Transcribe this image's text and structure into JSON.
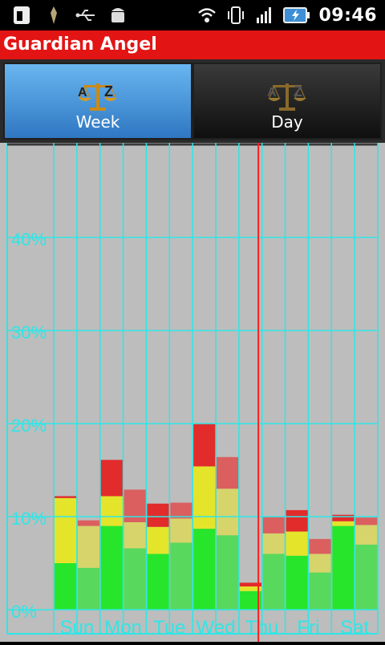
{
  "status_bar": {
    "time": "09:46",
    "icons": [
      "sim-card-icon",
      "notification-icon",
      "usb-icon",
      "android-debug-icon",
      "wifi-icon",
      "vibrate-icon",
      "signal-icon",
      "battery-charging-icon"
    ]
  },
  "app": {
    "title": "Guardian Angel"
  },
  "tabs": [
    {
      "label": "Week",
      "icon": "scales-icon",
      "selected": true
    },
    {
      "label": "Day",
      "icon": "scales-icon",
      "selected": false
    }
  ],
  "colors": {
    "grid": "#2fe6e6",
    "marker": "#ff2020",
    "background": "#bdbdbd",
    "red": "#e22b2b",
    "yellow": "#e4e42b",
    "green": "#27e52b",
    "red_light": "#db5f5f",
    "yellow_light": "#d6d46a",
    "green_light": "#59d85e"
  },
  "chart_data": {
    "type": "bar",
    "y_tick_labels": [
      "0%",
      "10%",
      "20%",
      "30%",
      "40%"
    ],
    "ylim": [
      0,
      50
    ],
    "x_tick_labels": [
      "Sun",
      "Mon",
      "Tue",
      "Wed",
      "Thu",
      "Fri",
      "Sat"
    ],
    "grid": true,
    "stack_order": [
      "green",
      "yellow",
      "red"
    ],
    "bars": [
      {
        "day": "Sun",
        "half": 1,
        "green": 5.0,
        "yellow": 7.0,
        "red": 0.2
      },
      {
        "day": "Sun",
        "half": 2,
        "green": 4.5,
        "yellow": 4.5,
        "red": 0.6
      },
      {
        "day": "Mon",
        "half": 1,
        "green": 9.0,
        "yellow": 3.2,
        "red": 3.9
      },
      {
        "day": "Mon",
        "half": 2,
        "green": 6.6,
        "yellow": 2.8,
        "red": 3.5
      },
      {
        "day": "Tue",
        "half": 1,
        "green": 6.0,
        "yellow": 2.9,
        "red": 2.5
      },
      {
        "day": "Tue",
        "half": 2,
        "green": 7.2,
        "yellow": 2.6,
        "red": 1.7
      },
      {
        "day": "Wed",
        "half": 1,
        "green": 8.7,
        "yellow": 6.7,
        "red": 4.6
      },
      {
        "day": "Wed",
        "half": 2,
        "green": 8.0,
        "yellow": 5.0,
        "red": 3.4
      },
      {
        "day": "Thu",
        "half": 1,
        "green": 2.0,
        "yellow": 0.5,
        "red": 0.4
      },
      {
        "day": "Thu",
        "half": 2,
        "green": 6.0,
        "yellow": 2.2,
        "red": 1.8
      },
      {
        "day": "Fri",
        "half": 1,
        "green": 5.8,
        "yellow": 2.6,
        "red": 2.3
      },
      {
        "day": "Fri",
        "half": 2,
        "green": 4.0,
        "yellow": 2.0,
        "red": 1.6
      },
      {
        "day": "Sat",
        "half": 1,
        "green": 9.0,
        "yellow": 0.5,
        "red": 0.7
      },
      {
        "day": "Sat",
        "half": 2,
        "green": 7.0,
        "yellow": 2.1,
        "red": 0.8
      }
    ],
    "current_time_marker": "Thu"
  }
}
